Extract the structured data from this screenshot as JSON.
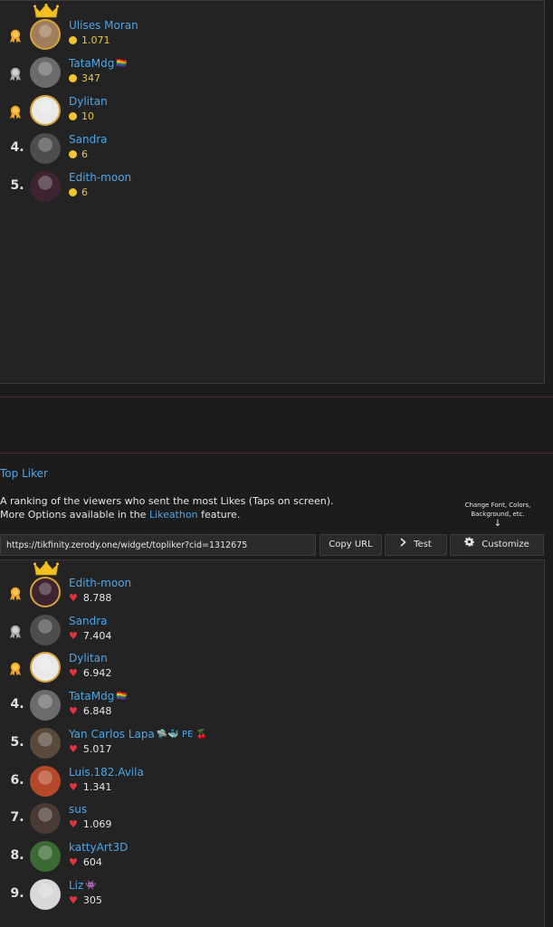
{
  "coin_ranking": [
    {
      "rank": "",
      "medal": "gold",
      "crown": true,
      "name": "Ulises Moran",
      "value": "1.071",
      "avatar": "#a07d5c"
    },
    {
      "rank": "",
      "medal": "silver",
      "crown": false,
      "name": "TataMdg",
      "flag": "🏳️‍🌈",
      "value": "347",
      "avatar": "#6b6b6b"
    },
    {
      "rank": "",
      "medal": "bronze",
      "crown": false,
      "name": "Dylitan",
      "value": "10",
      "avatar": "#e9e9e9"
    },
    {
      "rank": "4.",
      "medal": "",
      "crown": false,
      "name": "Sandra",
      "value": "6",
      "avatar": "#4d4d4d"
    },
    {
      "rank": "5.",
      "medal": "",
      "crown": false,
      "name": "Edith-moon",
      "value": "6",
      "avatar": "#3e2430"
    }
  ],
  "top_liker": {
    "title": "Top Liker",
    "desc_line1": "A ranking of the viewers who sent the most Likes (Taps on screen).",
    "desc_line2_pre": "More Options available in the ",
    "desc_link": "Likeathon",
    "desc_line2_post": " feature.",
    "hint_line1": "Change Font, Colors,",
    "hint_line2": "Background, etc.",
    "hint_arrow": "↓",
    "url": "https://tikfinity.zerody.one/widget/topliker?cid=1312675",
    "copy_label": "Copy URL",
    "test_label": "Test",
    "customize_label": "Customize",
    "test_icon": "chevron-right-icon",
    "customize_icon": "gear-icon"
  },
  "like_ranking": [
    {
      "rank": "",
      "medal": "gold",
      "crown": true,
      "name": "Edith-moon",
      "value": "8.788",
      "avatar": "#3e2430"
    },
    {
      "rank": "",
      "medal": "silver",
      "crown": false,
      "name": "Sandra",
      "value": "7.404",
      "avatar": "#4d4d4d"
    },
    {
      "rank": "",
      "medal": "bronze",
      "crown": false,
      "name": "Dylitan",
      "value": "6.942",
      "avatar": "#e9e9e9"
    },
    {
      "rank": "4.",
      "medal": "",
      "crown": false,
      "name": "TataMdg",
      "flag": "🏳️‍🌈",
      "value": "6.848",
      "avatar": "#6b6b6b"
    },
    {
      "rank": "5.",
      "medal": "",
      "crown": false,
      "name": "Yan Carlos Lapa",
      "flag": "🛸🐳 PE 🍒",
      "value": "5.017",
      "avatar": "#5a4a3c"
    },
    {
      "rank": "6.",
      "medal": "",
      "crown": false,
      "name": "Luis.182.Avila",
      "value": "1.341",
      "avatar": "#b5482a"
    },
    {
      "rank": "7.",
      "medal": "",
      "crown": false,
      "name": "sus",
      "value": "1.069",
      "avatar": "#4a3a35"
    },
    {
      "rank": "8.",
      "medal": "",
      "crown": false,
      "name": "kattyArt3D",
      "value": "604",
      "avatar": "#3b6a35"
    },
    {
      "rank": "9.",
      "medal": "",
      "crown": false,
      "name": "Liz",
      "flag": "👾",
      "value": "305",
      "avatar": "#d8d8d8"
    }
  ],
  "colors": {
    "accent": "#4ba6e8",
    "coin": "#f2c531",
    "heart": "#e3343f",
    "gold": "#d6a33a"
  }
}
